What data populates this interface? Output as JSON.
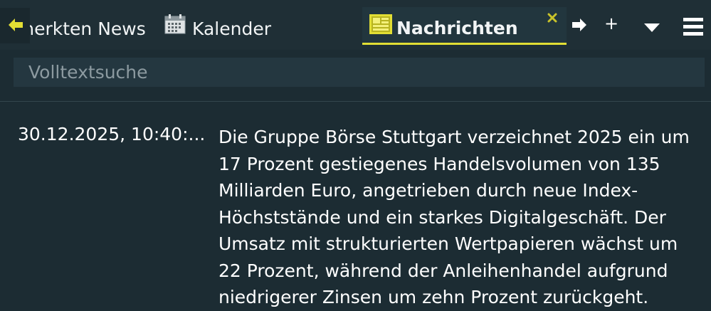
{
  "tabs": [
    {
      "label": "Gemerkten News"
    },
    {
      "label": "Kalender"
    },
    {
      "label": "Nachrichten"
    }
  ],
  "search": {
    "placeholder": "Volltextsuche"
  },
  "news": [
    {
      "time": "30.12.2025, 10:40:...",
      "text": "Die Gruppe Börse Stuttgart verzeichnet 2025 ein um 17 Prozent gestiegenes Handelsvolumen von 135 Milliarden Euro, angetrieben durch neue Index-Höchststände und ein starkes Digitalgeschäft. Der Umsatz mit strukturierten Wertpapieren wächst um 22 Prozent, während der Anleihenhandel aufgrund niedrigerer Zinsen um zehn Prozent zurückgeht."
    }
  ],
  "colors": {
    "accent": "#e2de34",
    "background": "#1c2c33",
    "tab_active": "#22363e"
  }
}
